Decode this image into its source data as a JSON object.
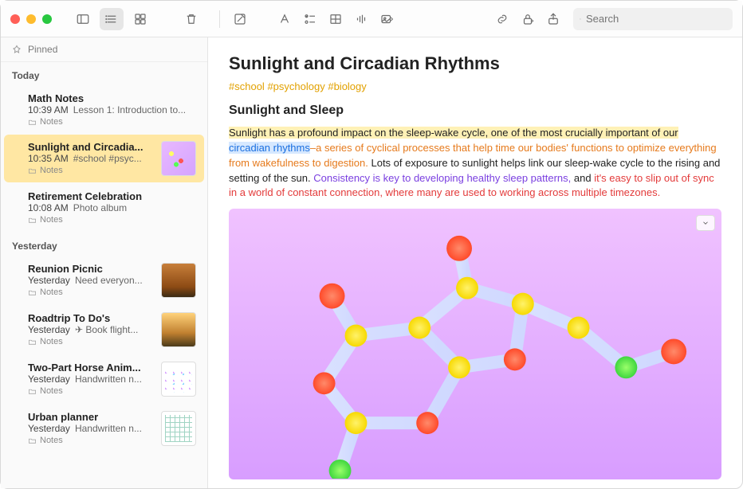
{
  "pinned_label": "Pinned",
  "search_placeholder": "Search",
  "sections": {
    "today": "Today",
    "yesterday": "Yesterday"
  },
  "notes": {
    "today": [
      {
        "title": "Math Notes",
        "time": "10:39 AM",
        "preview": "Lesson 1: Introduction to...",
        "folder": "Notes",
        "thumb": null,
        "selected": false
      },
      {
        "title": "Sunlight and Circadia...",
        "time": "10:35 AM",
        "preview": "#school #psyc...",
        "folder": "Notes",
        "thumb": "mol",
        "selected": true
      },
      {
        "title": "Retirement Celebration",
        "time": "10:08 AM",
        "preview": "Photo album",
        "folder": "Notes",
        "thumb": null,
        "selected": false
      }
    ],
    "yesterday": [
      {
        "title": "Reunion Picnic",
        "time": "Yesterday",
        "preview": "Need everyon...",
        "folder": "Notes",
        "thumb": "photo",
        "selected": false
      },
      {
        "title": "Roadtrip To Do's",
        "time": "Yesterday",
        "preview": "✈︎ Book flight...",
        "folder": "Notes",
        "thumb": "bike",
        "selected": false
      },
      {
        "title": "Two-Part Horse Anim...",
        "time": "Yesterday",
        "preview": "Handwritten n...",
        "folder": "Notes",
        "thumb": "doodle",
        "selected": false
      },
      {
        "title": "Urban planner",
        "time": "Yesterday",
        "preview": "Handwritten n...",
        "folder": "Notes",
        "thumb": "plan",
        "selected": false
      }
    ]
  },
  "note": {
    "title": "Sunlight and Circadian Rhythms",
    "tags": [
      "#school",
      "#psychology",
      "#biology"
    ],
    "subtitle": "Sunlight and Sleep",
    "p1_a": "Sunlight has a profound impact on the sleep-wake cycle, one of the most crucially important of our ",
    "p1_link": "circadian rhythms",
    "p1_b": "–a series of cyclical processes that help time our bodies' functions to optimize everything from wakefulness to digestion.",
    "p1_c": " Lots of exposure to sunlight helps link our sleep-wake cycle to the rising and setting of the sun. ",
    "p1_d": "Consistency is key to developing healthy sleep patterns,",
    "p1_e": " and ",
    "p1_f": "it's easy to slip out of sync in a world of constant connection, where many are used to working across multiple timezones."
  }
}
